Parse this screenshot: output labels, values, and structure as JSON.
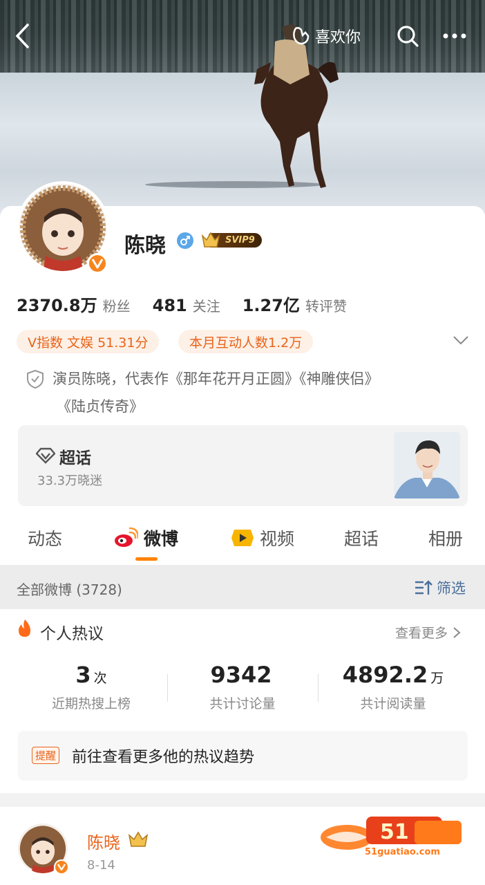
{
  "header": {
    "like_label": "喜欢你"
  },
  "profile": {
    "name": "陈晓",
    "svip": "SVIP9",
    "followers_num": "2370.8万",
    "followers_label": "粉丝",
    "following_num": "481",
    "following_label": "关注",
    "interactions_num": "1.27亿",
    "interactions_label": "转评赞",
    "v_index": "V指数 文娱 51.31分",
    "monthly": "本月互动人数1.2万",
    "intro_line1": "演员陈晓，代表作《那年花开月正圆》《神雕侠侣》",
    "intro_line2": "《陆贞传奇》"
  },
  "supertopic": {
    "title": "超话",
    "fans": "33.3万晓迷"
  },
  "tabs": [
    "动态",
    "微博",
    "视频",
    "超话",
    "相册"
  ],
  "feed": {
    "title": "全部微博 (3728)",
    "filter": "筛选"
  },
  "hot": {
    "title": "个人热议",
    "more": "查看更多",
    "stats": [
      {
        "value": "3",
        "unit": "次",
        "label": "近期热搜上榜"
      },
      {
        "value": "9342",
        "unit": "",
        "label": "共计讨论量"
      },
      {
        "value": "4892.2",
        "unit": "万",
        "label": "共计阅读量"
      }
    ],
    "reminder_tag": "提醒",
    "reminder_text": "前往查看更多他的热议趋势"
  },
  "post": {
    "name": "陈晓",
    "date": "8-14"
  },
  "watermark": {
    "text": "51guatiao.com"
  },
  "colors": {
    "accent": "#ff8200",
    "orange_text": "#e8631a",
    "link_blue": "#4a6f9c"
  }
}
